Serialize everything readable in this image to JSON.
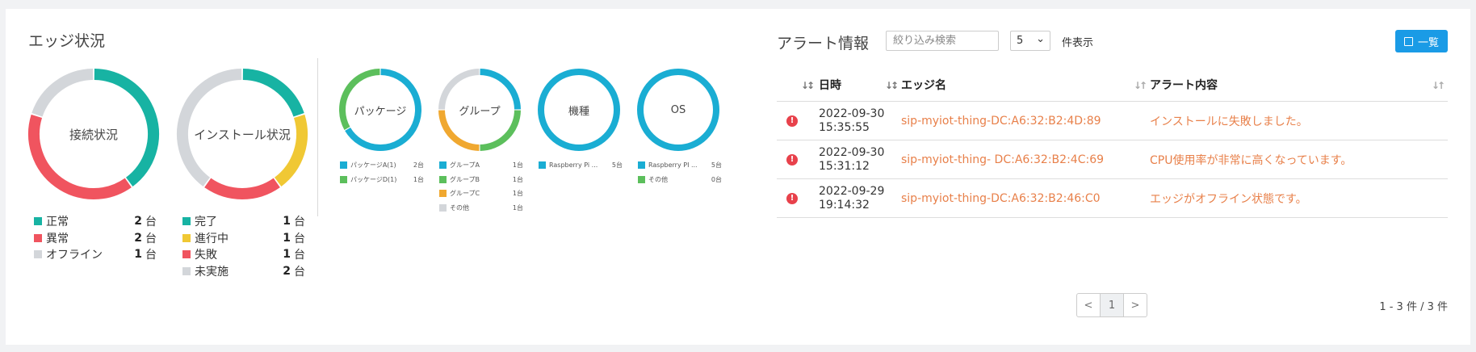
{
  "edge": {
    "title": "エッジ状況",
    "connection": {
      "label": "接続状況",
      "legend": [
        {
          "label": "正常",
          "count": "2",
          "unit": "台",
          "color": "#17b3a3",
          "value": 2
        },
        {
          "label": "異常",
          "count": "2",
          "unit": "台",
          "color": "#f0545f",
          "value": 2
        },
        {
          "label": "オフライン",
          "count": "1",
          "unit": "台",
          "color": "#d3d6da",
          "value": 1
        }
      ]
    },
    "install": {
      "label": "インストール状況",
      "legend": [
        {
          "label": "完了",
          "count": "1",
          "unit": "台",
          "color": "#17b3a3",
          "value": 1
        },
        {
          "label": "進行中",
          "count": "1",
          "unit": "台",
          "color": "#f0c834",
          "value": 1
        },
        {
          "label": "失敗",
          "count": "1",
          "unit": "台",
          "color": "#f0545f",
          "value": 1
        },
        {
          "label": "未実施",
          "count": "2",
          "unit": "台",
          "color": "#d3d6da",
          "value": 2
        }
      ]
    },
    "small_charts": [
      {
        "label": "パッケージ",
        "legend": [
          {
            "label": "パッケージA(1)",
            "count": "2台",
            "color": "#1aadd3",
            "value": 2
          },
          {
            "label": "パッケージD(1)",
            "count": "1台",
            "color": "#5cbf5c",
            "value": 1
          }
        ]
      },
      {
        "label": "グループ",
        "legend": [
          {
            "label": "グループA",
            "count": "1台",
            "color": "#1aadd3",
            "value": 1
          },
          {
            "label": "グループB",
            "count": "1台",
            "color": "#5cbf5c",
            "value": 1
          },
          {
            "label": "グループC",
            "count": "1台",
            "color": "#f0a830",
            "value": 1
          },
          {
            "label": "その他",
            "count": "1台",
            "color": "#d3d6da",
            "value": 1
          }
        ]
      },
      {
        "label": "機種",
        "legend": [
          {
            "label": "Raspberry Pi ...",
            "count": "5台",
            "color": "#1aadd3",
            "value": 5
          }
        ]
      },
      {
        "label": "OS",
        "legend": [
          {
            "label": "Raspberry PI ...",
            "count": "5台",
            "color": "#1aadd3",
            "value": 5
          },
          {
            "label": "その他",
            "count": "0台",
            "color": "#5cbf5c",
            "value": 0
          }
        ]
      }
    ]
  },
  "alerts": {
    "title": "アラート情報",
    "search_placeholder": "絞り込み検索",
    "per_page": "5",
    "per_page_label": "件表示",
    "list_button": "一覧",
    "columns": [
      "日時",
      "エッジ名",
      "アラート内容"
    ],
    "rows": [
      {
        "date": "2022-09-30",
        "time": "15:35:55",
        "edge": "sip-myiot-thing-DC:A6:32:B2:4D:89",
        "message": "インストールに失敗しました。"
      },
      {
        "date": "2022-09-30",
        "time": "15:31:12",
        "edge": "sip-myiot-thing- DC:A6:32:B2:4C:69",
        "message": "CPU使用率が非常に高くなっています。"
      },
      {
        "date": "2022-09-29",
        "time": "19:14:32",
        "edge": "sip-myiot-thing-DC:A6:32:B2:46:C0",
        "message": "エッジがオフライン状態です。"
      }
    ],
    "pager": {
      "prev": "<",
      "current": "1",
      "next": ">"
    },
    "page_info": "1 - 3 件 / 3 件"
  }
}
